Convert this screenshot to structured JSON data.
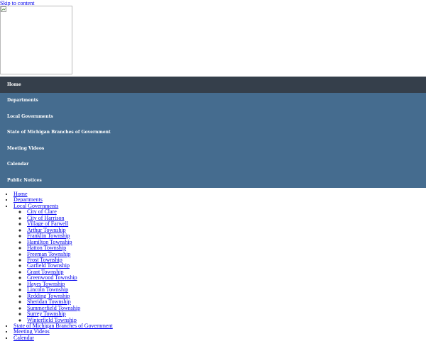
{
  "skip_link": "Skip to content",
  "nav": {
    "items": [
      {
        "label": "Home"
      },
      {
        "label": "Departments"
      },
      {
        "label": "Local Governments"
      },
      {
        "label": "State of Michigan Branches of Government"
      },
      {
        "label": "Meeting Videos"
      },
      {
        "label": "Calendar"
      },
      {
        "label": "Public Notices"
      }
    ]
  },
  "sitemap": {
    "home": "Home",
    "departments": "Departments",
    "local_governments": "Local Governments",
    "sub": [
      {
        "label": "City of Clare"
      },
      {
        "label": "City of Harrison"
      },
      {
        "label": "Village of Farwell"
      },
      {
        "label": "Arthur Township"
      },
      {
        "label": "Franklin Township"
      },
      {
        "label": "Hamilton Township"
      },
      {
        "label": "Hatton Township"
      },
      {
        "label": "Freeman Township"
      },
      {
        "label": "Frost Township"
      },
      {
        "label": "Garfield Township"
      },
      {
        "label": "Grant Township"
      },
      {
        "label": "Greenwood Township"
      },
      {
        "label": "Hayes Township"
      },
      {
        "label": "Lincoln Township"
      },
      {
        "label": "Redding Township"
      },
      {
        "label": "Sheridan Township"
      },
      {
        "label": "Summerfield Township"
      },
      {
        "label": "Surrey Township"
      },
      {
        "label": "Winterfield Township"
      }
    ],
    "state_branches": "State of Michigan Branches of Government",
    "meeting_videos": "Meeting Videos",
    "calendar": "Calendar"
  },
  "colors": {
    "nav_bg": "#456c8f",
    "nav_active": "#353f4b"
  }
}
